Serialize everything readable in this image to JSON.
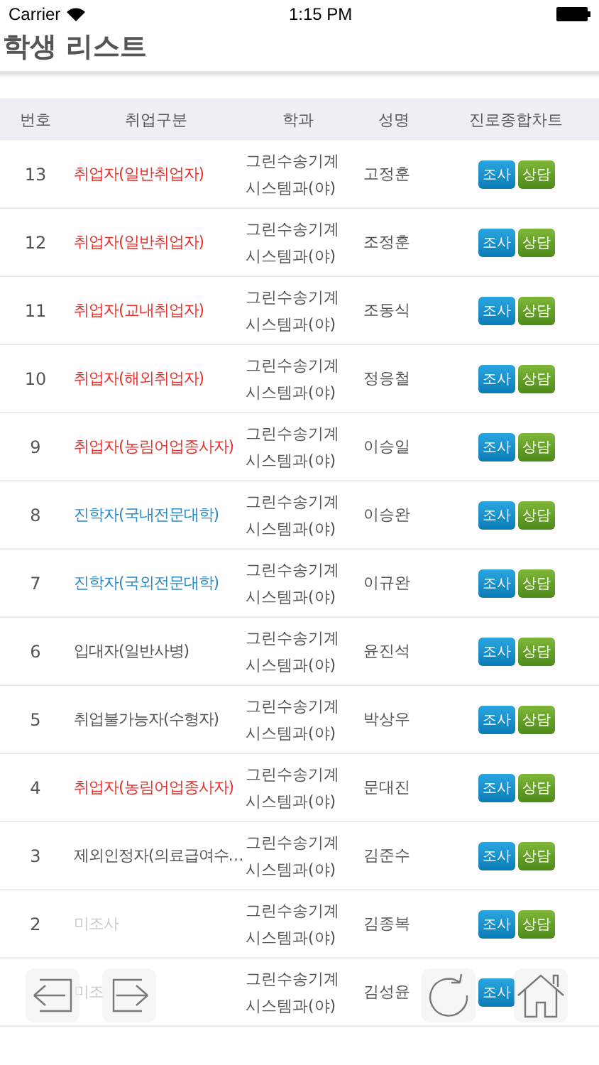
{
  "status_bar": {
    "carrier": "Carrier",
    "time": "1:15 PM"
  },
  "title": "학생 리스트",
  "table": {
    "columns": [
      "번호",
      "취업구분",
      "학과",
      "성명",
      "진로종합차트"
    ],
    "rows": [
      {
        "number": "13",
        "category": "취업자(일반취업자)",
        "kind": "employed",
        "department": [
          "그린수송기계",
          "시스템과(야)"
        ],
        "name": "고정훈",
        "survey": "조사",
        "consult": "상담"
      },
      {
        "number": "12",
        "category": "취업자(일반취업자)",
        "kind": "employed",
        "department": [
          "그린수송기계",
          "시스템과(야)"
        ],
        "name": "조정훈",
        "survey": "조사",
        "consult": "상담"
      },
      {
        "number": "11",
        "category": "취업자(교내취업자)",
        "kind": "employed",
        "department": [
          "그린수송기계",
          "시스템과(야)"
        ],
        "name": "조동식",
        "survey": "조사",
        "consult": "상담"
      },
      {
        "number": "10",
        "category": "취업자(해외취업자)",
        "kind": "employed",
        "department": [
          "그린수송기계",
          "시스템과(야)"
        ],
        "name": "정응철",
        "survey": "조사",
        "consult": "상담"
      },
      {
        "number": "9",
        "category": "취업자(농림어업종사자)",
        "kind": "employed",
        "department": [
          "그린수송기계",
          "시스템과(야)"
        ],
        "name": "이승일",
        "survey": "조사",
        "consult": "상담"
      },
      {
        "number": "8",
        "category": "진학자(국내전문대학)",
        "kind": "advanced",
        "department": [
          "그린수송기계",
          "시스템과(야)"
        ],
        "name": "이승완",
        "survey": "조사",
        "consult": "상담"
      },
      {
        "number": "7",
        "category": "진학자(국외전문대학)",
        "kind": "advanced",
        "department": [
          "그린수송기계",
          "시스템과(야)"
        ],
        "name": "이규완",
        "survey": "조사",
        "consult": "상담"
      },
      {
        "number": "6",
        "category": "입대자(일반사병)",
        "kind": "other",
        "department": [
          "그린수송기계",
          "시스템과(야)"
        ],
        "name": "윤진석",
        "survey": "조사",
        "consult": "상담"
      },
      {
        "number": "5",
        "category": "취업불가능자(수형자)",
        "kind": "other",
        "department": [
          "그린수송기계",
          "시스템과(야)"
        ],
        "name": "박상우",
        "survey": "조사",
        "consult": "상담"
      },
      {
        "number": "4",
        "category": "취업자(농림어업종사자)",
        "kind": "employed",
        "department": [
          "그린수송기계",
          "시스템과(야)"
        ],
        "name": "문대진",
        "survey": "조사",
        "consult": "상담"
      },
      {
        "number": "3",
        "category": "제외인정자(의료급여수…",
        "kind": "other",
        "department": [
          "그린수송기계",
          "시스템과(야)"
        ],
        "name": "김준수",
        "survey": "조사",
        "consult": "상담"
      },
      {
        "number": "2",
        "category": "미조사",
        "kind": "unsurveyed",
        "department": [
          "그린수송기계",
          "시스템과(야)"
        ],
        "name": "김종복",
        "survey": "조사",
        "consult": "상담"
      },
      {
        "category": "미조",
        "kind": "unsurveyed",
        "department": [
          "그린수송기계",
          "시스템과(야)"
        ],
        "name": "김성윤",
        "survey": "조사"
      }
    ]
  }
}
